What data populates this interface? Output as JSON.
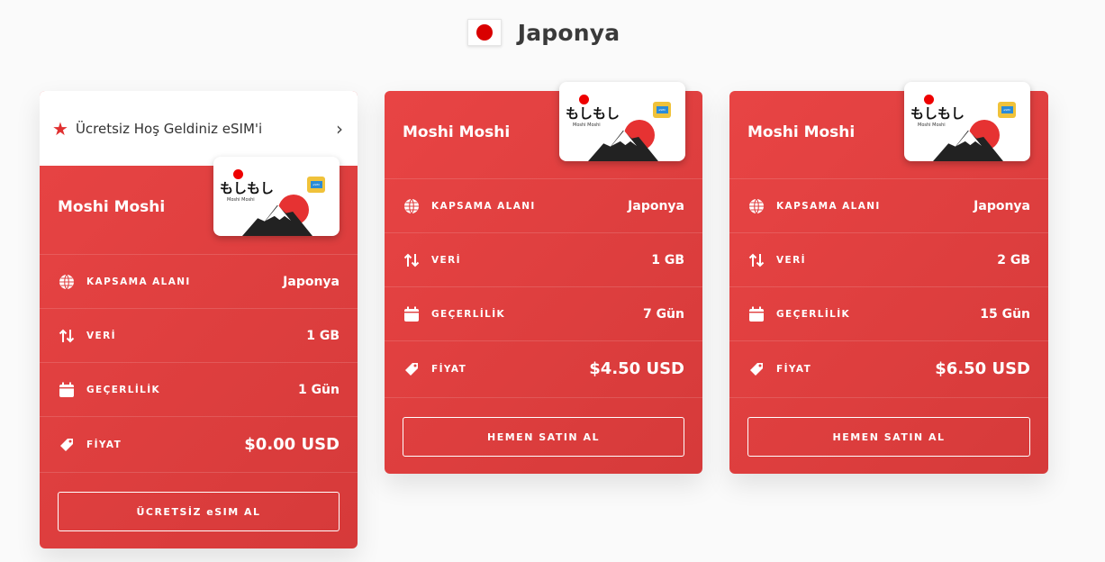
{
  "header": {
    "country": "Japonya",
    "flag_icon": "japan-flag"
  },
  "promo": {
    "text": "Ücretsiz Hoş Geldiniz eSIM'i",
    "star_icon": "★",
    "chevron": "›"
  },
  "sim": {
    "brand": "もしもし",
    "brand_sub": "Moshi Moshi",
    "chip_label": "eSIM"
  },
  "labels": {
    "coverage": "KAPSAMA ALANI",
    "data": "VERİ",
    "validity": "GEÇERLİLİK",
    "price": "FİYAT"
  },
  "plans": [
    {
      "name": "Moshi Moshi",
      "coverage": "Japonya",
      "data": "1 GB",
      "validity": "1 Gün",
      "price": "$0.00 USD",
      "button": "ÜCRETSİZ eSIM AL"
    },
    {
      "name": "Moshi Moshi",
      "coverage": "Japonya",
      "data": "1 GB",
      "validity": "7 Gün",
      "price": "$4.50 USD",
      "button": "HEMEN SATIN AL"
    },
    {
      "name": "Moshi Moshi",
      "coverage": "Japonya",
      "data": "2 GB",
      "validity": "15 Gün",
      "price": "$6.50 USD",
      "button": "HEMEN SATIN AL"
    }
  ],
  "colors": {
    "card_red": "#e84444",
    "flag_red": "#d90000"
  }
}
